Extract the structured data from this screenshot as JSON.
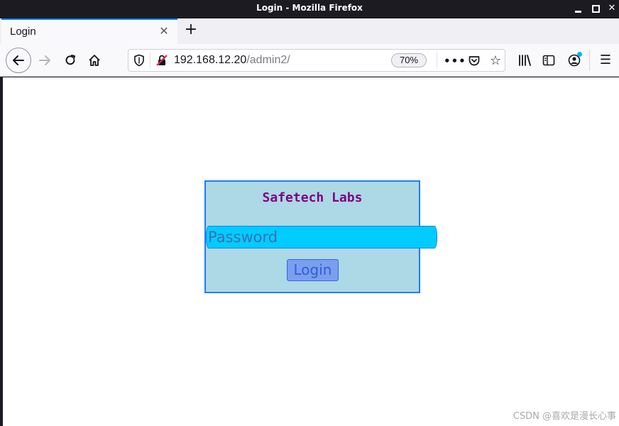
{
  "window": {
    "title": "Login - Mozilla Firefox"
  },
  "tabs": [
    {
      "label": "Login",
      "active": true
    }
  ],
  "nav": {
    "url_host": "192.168.12.20",
    "url_path": "/admin2/",
    "zoom": "70%"
  },
  "page": {
    "brand": "Safetech Labs",
    "password_placeholder": "Password",
    "login_label": "Login"
  },
  "watermark": "CSDN @喜欢是漫长心事",
  "colors": {
    "box_bg": "#add8e6",
    "box_border": "#1e7ff0",
    "brand_text": "#800080",
    "input_bg": "#00ccff",
    "button_bg": "#7b9ff0"
  },
  "icons": {
    "back": "arrow-left-icon",
    "forward": "arrow-right-icon",
    "reload": "reload-icon",
    "home": "home-icon",
    "tracking": "shield-icon",
    "insecure": "insecure-lock-icon",
    "more": "more-actions-icon",
    "pocket": "pocket-icon",
    "bookmark": "star-icon",
    "library": "library-icon",
    "sidebar": "sidebar-icon",
    "account": "account-icon",
    "menu": "hamburger-menu-icon"
  }
}
